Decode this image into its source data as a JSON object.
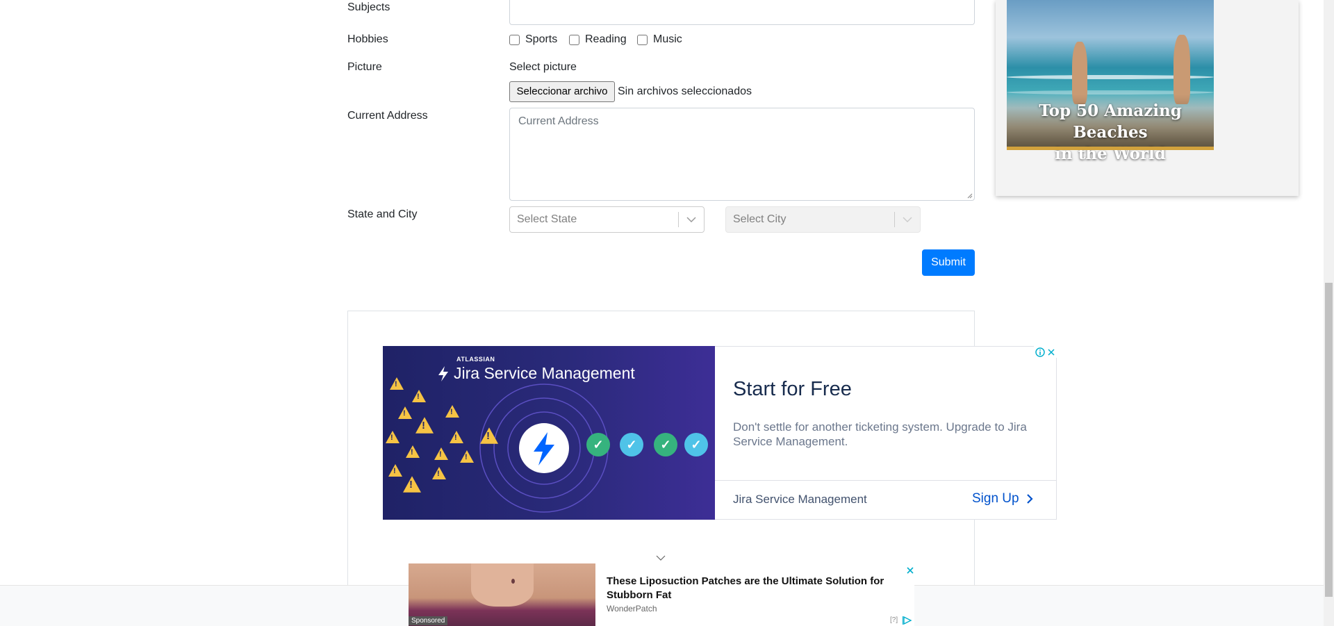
{
  "form": {
    "subjects_label": "Subjects",
    "hobbies_label": "Hobbies",
    "hobbies": [
      {
        "label": "Sports",
        "checked": false
      },
      {
        "label": "Reading",
        "checked": false
      },
      {
        "label": "Music",
        "checked": false
      }
    ],
    "picture_label": "Picture",
    "select_picture_text": "Select picture",
    "file_button_label": "Seleccionar archivo",
    "file_status": "Sin archivos seleccionados",
    "address_label": "Current Address",
    "address_placeholder": "Current Address",
    "state_city_label": "State and City",
    "state_placeholder": "Select State",
    "city_placeholder": "Select City",
    "submit_label": "Submit"
  },
  "side_ad": {
    "title_line1": "Top 50 Amazing Beaches",
    "title_line2": "in the World"
  },
  "jira_ad": {
    "brand_small": "ATLASSIAN",
    "brand": "Jira Service Management",
    "headline": "Start for Free",
    "body": "Don't settle for another ticketing system. Upgrade to Jira Service Management.",
    "advertiser": "Jira Service Management",
    "cta": "Sign Up"
  },
  "bottom_ad": {
    "headline": "These Liposuction Patches are the Ultimate Solution for Stubborn Fat",
    "advertiser": "WonderPatch",
    "sponsored": "Sponsored",
    "help": "[?]"
  },
  "colors": {
    "primary": "#007bff",
    "jira_blue": "#0052cc",
    "check_green": "#36b37e",
    "check_cyan": "#4fc3e8"
  }
}
